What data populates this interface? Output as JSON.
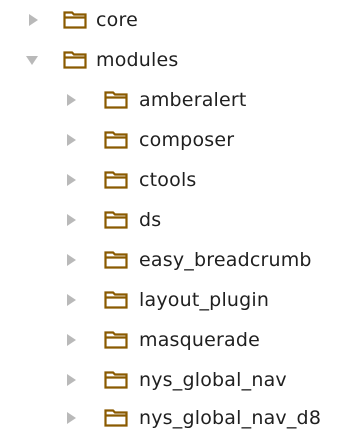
{
  "colors": {
    "folder_stroke": "#8a5a00",
    "folder_fill": "#ffffff",
    "arrow": "#b9b9b9",
    "text": "#1f1f1f"
  },
  "tree": {
    "items": [
      {
        "label": "core",
        "level": 0,
        "state": "collapsed",
        "icon": "folder-icon"
      },
      {
        "label": "modules",
        "level": 0,
        "state": "expanded",
        "icon": "folder-icon"
      },
      {
        "label": "amberalert",
        "level": 1,
        "state": "collapsed",
        "icon": "folder-icon"
      },
      {
        "label": "composer",
        "level": 1,
        "state": "collapsed",
        "icon": "folder-icon"
      },
      {
        "label": "ctools",
        "level": 1,
        "state": "collapsed",
        "icon": "folder-icon"
      },
      {
        "label": "ds",
        "level": 1,
        "state": "collapsed",
        "icon": "folder-icon"
      },
      {
        "label": "easy_breadcrumb",
        "level": 1,
        "state": "collapsed",
        "icon": "folder-icon"
      },
      {
        "label": "layout_plugin",
        "level": 1,
        "state": "collapsed",
        "icon": "folder-icon"
      },
      {
        "label": "masquerade",
        "level": 1,
        "state": "collapsed",
        "icon": "folder-icon"
      },
      {
        "label": "nys_global_nav",
        "level": 1,
        "state": "collapsed",
        "icon": "folder-icon"
      },
      {
        "label": "nys_global_nav_d8",
        "level": 1,
        "state": "collapsed",
        "icon": "folder-icon"
      }
    ]
  }
}
